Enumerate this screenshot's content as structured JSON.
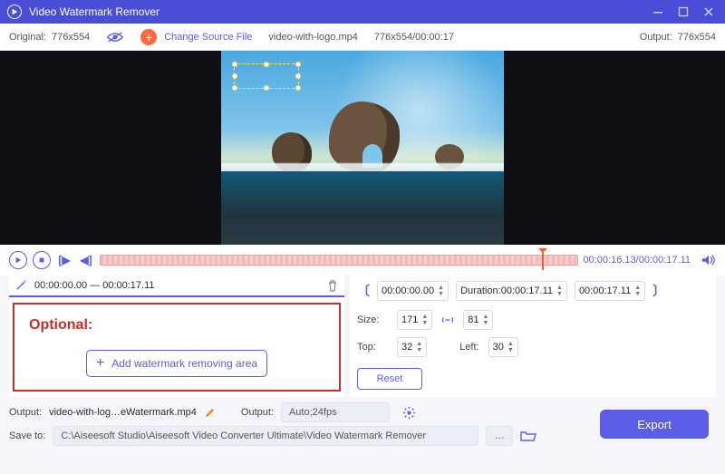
{
  "app": {
    "title": "Video Watermark Remover"
  },
  "topbar": {
    "original_label": "Original:",
    "original_dim": "776x554",
    "change_source": "Change Source File",
    "filename": "video-with-logo.mp4",
    "src_info": "776x554/00:00:17",
    "output_label": "Output:",
    "output_dim": "776x554"
  },
  "transport": {
    "time_current": "00:00:16.13",
    "time_total": "00:00:17.11"
  },
  "segment": {
    "range": "00:00:00.00 — 00:00:17.11"
  },
  "optional": {
    "title": "Optional:",
    "add_button": "Add watermark removing area"
  },
  "controls": {
    "range_start": "00:00:00.00",
    "duration_label": "Duration:",
    "duration_value": "00:00:17.11",
    "range_end": "00:00:17.11",
    "size_label": "Size:",
    "size_w": "171",
    "size_h": "81",
    "top_label": "Top:",
    "top_v": "32",
    "left_label": "Left:",
    "left_v": "30",
    "reset": "Reset"
  },
  "output": {
    "label": "Output:",
    "filename": "video-with-log…eWatermark.mp4",
    "format_label": "Output:",
    "format_value": "Auto;24fps"
  },
  "save": {
    "label": "Save to:",
    "path": "C:\\Aiseesoft Studio\\Aiseesoft Video Converter Ultimate\\Video Watermark Remover"
  },
  "export": {
    "label": "Export"
  }
}
